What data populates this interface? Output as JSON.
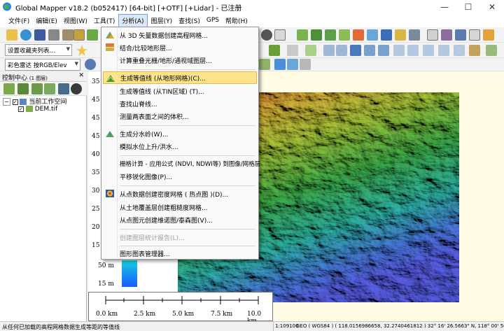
{
  "window": {
    "title": "Global Mapper v18.2 (b052417) [64-bit] [+OTF] [+Lidar] - 已注册",
    "minimize": "—",
    "maximize": "☐",
    "close": "✕"
  },
  "menubar": [
    {
      "label": "文件(F)"
    },
    {
      "label": "编辑(E)"
    },
    {
      "label": "视图(W)"
    },
    {
      "label": "工具(T)"
    },
    {
      "label": "分析(A)"
    },
    {
      "label": "图层(Y)"
    },
    {
      "label": "查找(S)"
    },
    {
      "label": "GPS"
    },
    {
      "label": "帮助(H)"
    }
  ],
  "toolbar": {
    "favorites_combo": "设置收藏夹列表...",
    "shader_combo": "彩色雷达 按RGB/Elev"
  },
  "control_center": {
    "title": "控制中心",
    "count": "(1 图层)",
    "tree_root": "当前工作空间",
    "tree_layer": "DEM.tif"
  },
  "analysis_menu": {
    "items": [
      {
        "label": "从 3D 矢量数据创建高程网格...",
        "icon": "grid-icon"
      },
      {
        "label": "结合/比较地形层...",
        "icon": "combine-terrain-icon"
      },
      {
        "label": "计算重叠光栅/地形/通视域图层...",
        "icon": ""
      },
      {
        "label": "生成等值线 (从地形网格)(C)...",
        "icon": "contour-icon"
      },
      {
        "label": "生成等值线 (从TIN区域) (T)...",
        "icon": ""
      },
      {
        "label": "查找山脊线...",
        "icon": ""
      },
      {
        "label": "测量两表面之间的体积...",
        "icon": ""
      },
      {
        "label": "生成分水岭(W)...",
        "icon": "watershed-icon"
      },
      {
        "label": "模拟水位上升/洪水...",
        "icon": ""
      },
      {
        "label": "栅格计算 - 应用公式 (NDVI, NDWI等) 到图像/网格层",
        "icon": ""
      },
      {
        "label": "平移锐化图像(P)...",
        "icon": ""
      },
      {
        "label": "从点数据创建密度网格 ( 热点图 )(D)...",
        "icon": "density-icon"
      },
      {
        "label": "从土地覆盖层创建粗糙度网格...",
        "icon": ""
      },
      {
        "label": "从点图元创建维诺图/泰森图(V)...",
        "icon": ""
      },
      {
        "label": "创建图层统计报告(L)...",
        "icon": "",
        "disabled": true
      },
      {
        "label": "图形图表管理器...",
        "icon": ""
      }
    ]
  },
  "map": {
    "elevation_labels": [
      "35",
      "45",
      "45",
      "45",
      "40",
      "35",
      "30",
      "25",
      "20",
      "15",
      "10",
      "50 m",
      "15 m"
    ],
    "scale_labels": [
      "0.0 km",
      "2.5 km",
      "5.0 km",
      "7.5 km",
      "10.0 km"
    ]
  },
  "status": {
    "message": "从任何已加载的高程网格数据生成等距的等值线",
    "scale": "1:109100",
    "coords": "GEO ( WGS84 ) ( 118.0156986658, 32.2740461812 ) 32° 16' 26.5663\" N, 118° 00' 56.5152\" E"
  },
  "colors": {
    "menu_highlight": "#fde48c",
    "map_background": "#fffbe3"
  }
}
